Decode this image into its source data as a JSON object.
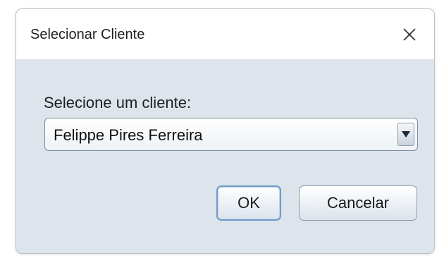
{
  "dialog": {
    "title": "Selecionar Cliente",
    "close_icon": "close-icon",
    "prompt": "Selecione um cliente:",
    "combo": {
      "selected": "Felippe Pires Ferreira",
      "arrow_icon": "triangle-down-icon"
    },
    "buttons": {
      "ok": "OK",
      "cancel": "Cancelar"
    }
  }
}
